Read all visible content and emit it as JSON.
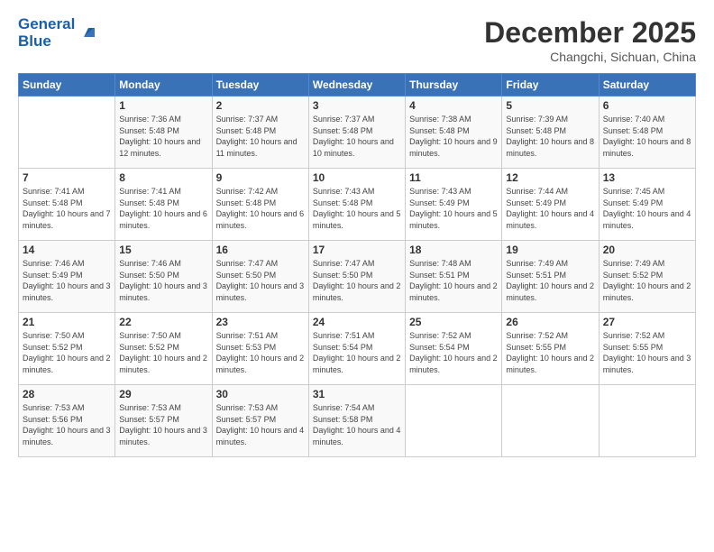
{
  "header": {
    "logo_line1": "General",
    "logo_line2": "Blue",
    "month_title": "December 2025",
    "location": "Changchi, Sichuan, China"
  },
  "days_of_week": [
    "Sunday",
    "Monday",
    "Tuesday",
    "Wednesday",
    "Thursday",
    "Friday",
    "Saturday"
  ],
  "weeks": [
    [
      {
        "day": "",
        "sunrise": "",
        "sunset": "",
        "daylight": ""
      },
      {
        "day": "1",
        "sunrise": "7:36 AM",
        "sunset": "5:48 PM",
        "daylight": "10 hours and 12 minutes."
      },
      {
        "day": "2",
        "sunrise": "7:37 AM",
        "sunset": "5:48 PM",
        "daylight": "10 hours and 11 minutes."
      },
      {
        "day": "3",
        "sunrise": "7:37 AM",
        "sunset": "5:48 PM",
        "daylight": "10 hours and 10 minutes."
      },
      {
        "day": "4",
        "sunrise": "7:38 AM",
        "sunset": "5:48 PM",
        "daylight": "10 hours and 9 minutes."
      },
      {
        "day": "5",
        "sunrise": "7:39 AM",
        "sunset": "5:48 PM",
        "daylight": "10 hours and 8 minutes."
      },
      {
        "day": "6",
        "sunrise": "7:40 AM",
        "sunset": "5:48 PM",
        "daylight": "10 hours and 8 minutes."
      }
    ],
    [
      {
        "day": "7",
        "sunrise": "7:41 AM",
        "sunset": "5:48 PM",
        "daylight": "10 hours and 7 minutes."
      },
      {
        "day": "8",
        "sunrise": "7:41 AM",
        "sunset": "5:48 PM",
        "daylight": "10 hours and 6 minutes."
      },
      {
        "day": "9",
        "sunrise": "7:42 AM",
        "sunset": "5:48 PM",
        "daylight": "10 hours and 6 minutes."
      },
      {
        "day": "10",
        "sunrise": "7:43 AM",
        "sunset": "5:48 PM",
        "daylight": "10 hours and 5 minutes."
      },
      {
        "day": "11",
        "sunrise": "7:43 AM",
        "sunset": "5:49 PM",
        "daylight": "10 hours and 5 minutes."
      },
      {
        "day": "12",
        "sunrise": "7:44 AM",
        "sunset": "5:49 PM",
        "daylight": "10 hours and 4 minutes."
      },
      {
        "day": "13",
        "sunrise": "7:45 AM",
        "sunset": "5:49 PM",
        "daylight": "10 hours and 4 minutes."
      }
    ],
    [
      {
        "day": "14",
        "sunrise": "7:46 AM",
        "sunset": "5:49 PM",
        "daylight": "10 hours and 3 minutes."
      },
      {
        "day": "15",
        "sunrise": "7:46 AM",
        "sunset": "5:50 PM",
        "daylight": "10 hours and 3 minutes."
      },
      {
        "day": "16",
        "sunrise": "7:47 AM",
        "sunset": "5:50 PM",
        "daylight": "10 hours and 3 minutes."
      },
      {
        "day": "17",
        "sunrise": "7:47 AM",
        "sunset": "5:50 PM",
        "daylight": "10 hours and 2 minutes."
      },
      {
        "day": "18",
        "sunrise": "7:48 AM",
        "sunset": "5:51 PM",
        "daylight": "10 hours and 2 minutes."
      },
      {
        "day": "19",
        "sunrise": "7:49 AM",
        "sunset": "5:51 PM",
        "daylight": "10 hours and 2 minutes."
      },
      {
        "day": "20",
        "sunrise": "7:49 AM",
        "sunset": "5:52 PM",
        "daylight": "10 hours and 2 minutes."
      }
    ],
    [
      {
        "day": "21",
        "sunrise": "7:50 AM",
        "sunset": "5:52 PM",
        "daylight": "10 hours and 2 minutes."
      },
      {
        "day": "22",
        "sunrise": "7:50 AM",
        "sunset": "5:52 PM",
        "daylight": "10 hours and 2 minutes."
      },
      {
        "day": "23",
        "sunrise": "7:51 AM",
        "sunset": "5:53 PM",
        "daylight": "10 hours and 2 minutes."
      },
      {
        "day": "24",
        "sunrise": "7:51 AM",
        "sunset": "5:54 PM",
        "daylight": "10 hours and 2 minutes."
      },
      {
        "day": "25",
        "sunrise": "7:52 AM",
        "sunset": "5:54 PM",
        "daylight": "10 hours and 2 minutes."
      },
      {
        "day": "26",
        "sunrise": "7:52 AM",
        "sunset": "5:55 PM",
        "daylight": "10 hours and 2 minutes."
      },
      {
        "day": "27",
        "sunrise": "7:52 AM",
        "sunset": "5:55 PM",
        "daylight": "10 hours and 3 minutes."
      }
    ],
    [
      {
        "day": "28",
        "sunrise": "7:53 AM",
        "sunset": "5:56 PM",
        "daylight": "10 hours and 3 minutes."
      },
      {
        "day": "29",
        "sunrise": "7:53 AM",
        "sunset": "5:57 PM",
        "daylight": "10 hours and 3 minutes."
      },
      {
        "day": "30",
        "sunrise": "7:53 AM",
        "sunset": "5:57 PM",
        "daylight": "10 hours and 4 minutes."
      },
      {
        "day": "31",
        "sunrise": "7:54 AM",
        "sunset": "5:58 PM",
        "daylight": "10 hours and 4 minutes."
      },
      {
        "day": "",
        "sunrise": "",
        "sunset": "",
        "daylight": ""
      },
      {
        "day": "",
        "sunrise": "",
        "sunset": "",
        "daylight": ""
      },
      {
        "day": "",
        "sunrise": "",
        "sunset": "",
        "daylight": ""
      }
    ]
  ]
}
